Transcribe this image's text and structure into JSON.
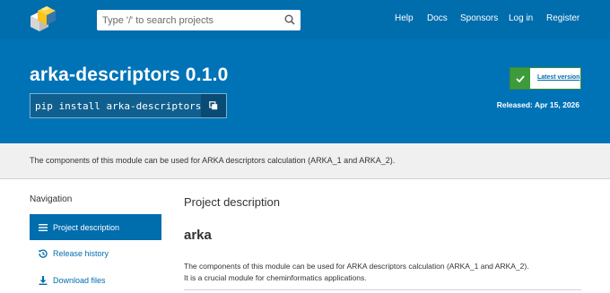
{
  "header": {
    "search_placeholder": "Type '/' to search projects",
    "nav": [
      "Help",
      "Docs",
      "Sponsors",
      "Log in",
      "Register"
    ]
  },
  "package": {
    "title": "arka-descriptors 0.1.0",
    "pip_command": "pip install arka-descriptors",
    "latest_label": "Latest version",
    "released": "Released: Apr 15, 2026"
  },
  "summary": "The components of this module can be used for ARKA descriptors calculation (ARKA_1 and ARKA_2).",
  "sidebar": {
    "title": "Navigation",
    "items": [
      {
        "label": "Project description",
        "icon": "list-icon"
      },
      {
        "label": "Release history",
        "icon": "history-icon"
      },
      {
        "label": "Download files",
        "icon": "download-icon"
      }
    ]
  },
  "main": {
    "title": "Project description",
    "heading": "arka",
    "paragraph_1": "The components of this module can be used for ARKA descriptors calculation (ARKA_1 and ARKA_2).",
    "paragraph_2": "It is a crucial module for cheminformatics applications."
  },
  "colors": {
    "header_blue": "#006dad",
    "hero_blue": "#0073b7",
    "check_green": "#3e9b3a"
  }
}
